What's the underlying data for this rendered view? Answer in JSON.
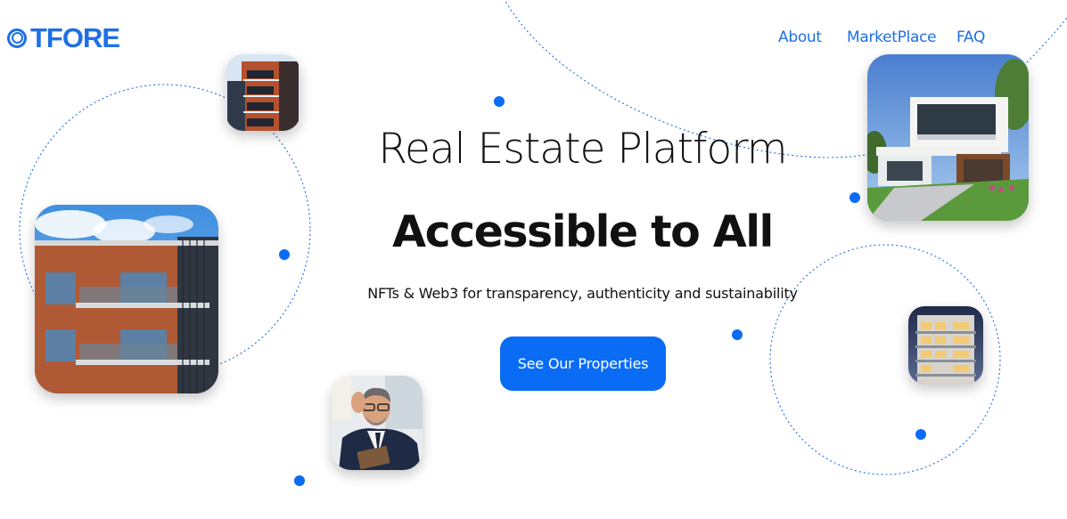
{
  "brand": {
    "logo_text": "TFORE"
  },
  "nav": {
    "items": [
      "About",
      "MarketPlace",
      "FAQ"
    ]
  },
  "hero": {
    "title": "Real Estate Platform",
    "subtitle": "Accessible to All",
    "tagline": "NFTs & Web3 for transparency, authenticity and sustainability",
    "cta_label": "See Our Properties"
  },
  "images": [
    {
      "name": "brick-tower-photo"
    },
    {
      "name": "apartment-building-photo"
    },
    {
      "name": "businessman-tablet-photo"
    },
    {
      "name": "modern-villa-photo"
    },
    {
      "name": "night-apartment-photo"
    }
  ],
  "colors": {
    "accent": "#0a6cf5",
    "brand": "#1f6fe5",
    "text": "#111111",
    "background": "#ffffff"
  }
}
